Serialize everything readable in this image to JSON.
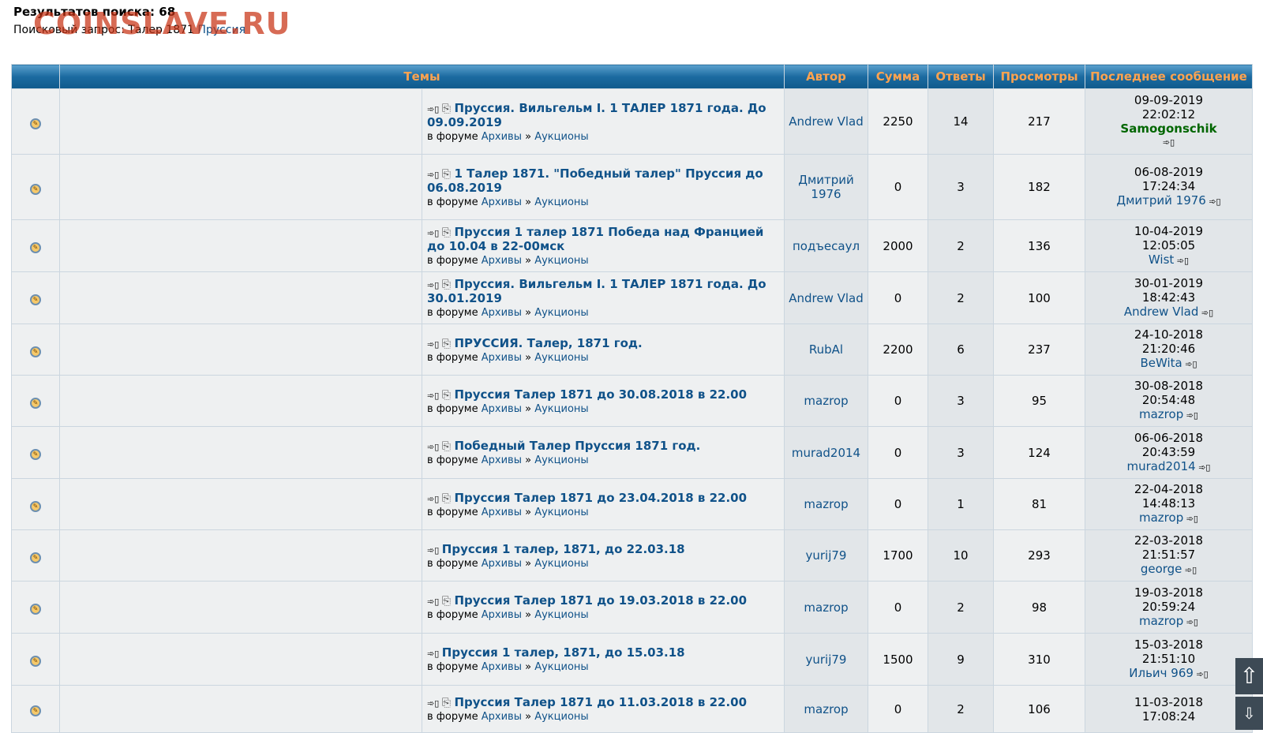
{
  "header": {
    "results_label": "Результатов поиска: 68",
    "query_label": "Поисковый запрос:",
    "query_terms": "Талер 1871",
    "query_last": "Пруссия"
  },
  "watermark": "COINSLAVE.RU",
  "columns": [
    "Темы",
    "Автор",
    "Сумма",
    "Ответы",
    "Просмотры",
    "Последнее сообщение"
  ],
  "forum_prefix": "в форуме",
  "forum_path": [
    "Архивы",
    "Аукционы"
  ],
  "rows": [
    {
      "title": "Пруссия. Вильгельм I. 1 ТАЛЕР 1871 года. До 09.09.2019",
      "attach": true,
      "author": "Andrew Vlad",
      "sum": "2250",
      "replies": "14",
      "views": "217",
      "date": "09-09-2019",
      "time": "22:02:12",
      "last_user": "Samogonschik",
      "mod": true
    },
    {
      "title": "1 Талер 1871. \"Победный талер\" Пруссия до 06.08.2019",
      "attach": true,
      "author": "Дмитрий 1976",
      "sum": "0",
      "replies": "3",
      "views": "182",
      "date": "06-08-2019",
      "time": "17:24:34",
      "last_user": "Дмитрий 1976",
      "mod": false
    },
    {
      "title": "Пруссия 1 талер 1871 Победа над Францией до 10.04 в 22-00мск",
      "attach": true,
      "author": "подъесаул",
      "sum": "2000",
      "replies": "2",
      "views": "136",
      "date": "10-04-2019",
      "time": "12:05:05",
      "last_user": "Wist",
      "mod": false
    },
    {
      "title": "Пруссия. Вильгельм I. 1 ТАЛЕР 1871 года. До 30.01.2019",
      "attach": true,
      "author": "Andrew Vlad",
      "sum": "0",
      "replies": "2",
      "views": "100",
      "date": "30-01-2019",
      "time": "18:42:43",
      "last_user": "Andrew Vlad",
      "mod": false
    },
    {
      "title": "ПРУССИЯ. Талер, 1871 год.",
      "attach": true,
      "author": "RubAl",
      "sum": "2200",
      "replies": "6",
      "views": "237",
      "date": "24-10-2018",
      "time": "21:20:46",
      "last_user": "BeWita",
      "mod": false
    },
    {
      "title": "Пруссия Талер 1871 до 30.08.2018 в 22.00",
      "attach": true,
      "author": "mazrop",
      "sum": "0",
      "replies": "3",
      "views": "95",
      "date": "30-08-2018",
      "time": "20:54:48",
      "last_user": "mazrop",
      "mod": false
    },
    {
      "title": "Победный Талер Пруссия 1871 год.",
      "attach": true,
      "author": "murad2014",
      "sum": "0",
      "replies": "3",
      "views": "124",
      "date": "06-06-2018",
      "time": "20:43:59",
      "last_user": "murad2014",
      "mod": false
    },
    {
      "title": "Пруссия Талер 1871 до 23.04.2018 в 22.00",
      "attach": true,
      "author": "mazrop",
      "sum": "0",
      "replies": "1",
      "views": "81",
      "date": "22-04-2018",
      "time": "14:48:13",
      "last_user": "mazrop",
      "mod": false
    },
    {
      "title": "Пруссия 1 талер, 1871, до 22.03.18",
      "attach": false,
      "author": "yurij79",
      "sum": "1700",
      "replies": "10",
      "views": "293",
      "date": "22-03-2018",
      "time": "21:51:57",
      "last_user": "george",
      "mod": false
    },
    {
      "title": "Пруссия Талер 1871 до 19.03.2018 в 22.00",
      "attach": true,
      "author": "mazrop",
      "sum": "0",
      "replies": "2",
      "views": "98",
      "date": "19-03-2018",
      "time": "20:59:24",
      "last_user": "mazrop",
      "mod": false
    },
    {
      "title": "Пруссия 1 талер, 1871, до 15.03.18",
      "attach": false,
      "author": "yurij79",
      "sum": "1500",
      "replies": "9",
      "views": "310",
      "date": "15-03-2018",
      "time": "21:51:10",
      "last_user": "Ильич 969",
      "mod": false
    },
    {
      "title": "Пруссия Талер 1871 до 11.03.2018 в 22.00",
      "attach": true,
      "author": "mazrop",
      "sum": "0",
      "replies": "2",
      "views": "106",
      "date": "11-03-2018",
      "time": "17:08:24",
      "last_user": "",
      "mod": false
    }
  ],
  "scroll_up_icon": "arrow-up-icon"
}
